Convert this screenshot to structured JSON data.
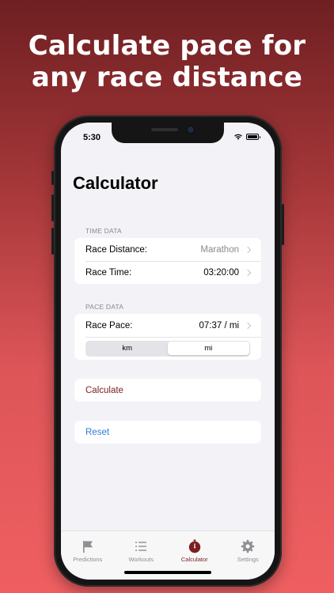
{
  "headline": {
    "line1": "Calculate pace for",
    "line2": "any race distance"
  },
  "status_bar": {
    "time": "5:30",
    "icons": [
      "wifi-icon",
      "battery-icon"
    ]
  },
  "page": {
    "title": "Calculator"
  },
  "time_data": {
    "header": "TIME DATA",
    "rows": [
      {
        "label": "Race Distance:",
        "value": "Marathon"
      },
      {
        "label": "Race Time:",
        "value": "03:20:00"
      }
    ]
  },
  "pace_data": {
    "header": "PACE DATA",
    "pace_label": "Race Pace:",
    "pace_value": "07:37 / mi",
    "unit_options": [
      "km",
      "mi"
    ],
    "unit_selected": "mi"
  },
  "actions": {
    "calculate": "Calculate",
    "reset": "Reset"
  },
  "tabs": [
    {
      "label": "Predictions",
      "icon": "flag-icon"
    },
    {
      "label": "Workouts",
      "icon": "list-icon"
    },
    {
      "label": "Calculator",
      "icon": "stopwatch-icon",
      "active": true
    },
    {
      "label": "Settings",
      "icon": "gear-icon"
    }
  ],
  "colors": {
    "accent": "#7a1f22",
    "link_blue": "#2f7ed8",
    "inactive_tab": "#8e8e93"
  }
}
